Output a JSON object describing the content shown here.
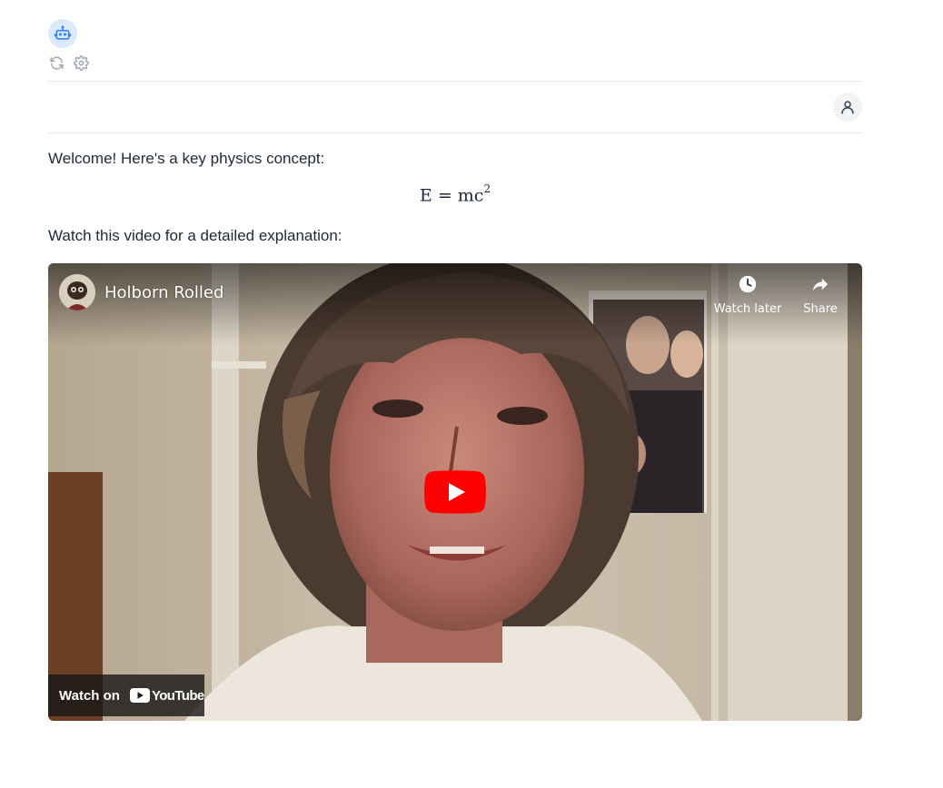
{
  "header": {
    "bot_avatar_icon": "robot-icon",
    "tools": [
      {
        "name": "refresh-icon"
      },
      {
        "name": "gear-icon"
      }
    ]
  },
  "user": {
    "avatar_icon": "user-icon"
  },
  "message": {
    "intro": "Welcome! Here's a key physics concept:",
    "equation_base": "E = mc",
    "equation_exponent": "2",
    "video_prompt": "Watch this video for a detailed explanation:"
  },
  "video": {
    "title": "Holborn Rolled",
    "watch_later_label": "Watch later",
    "share_label": "Share",
    "watch_on_label": "Watch on",
    "youtube_wordmark": "YouTube",
    "play_color": "#ff0000"
  },
  "colors": {
    "accent": "#3b82f6",
    "avatar_bg": "#dbeafe",
    "divider": "#e5e7eb"
  }
}
